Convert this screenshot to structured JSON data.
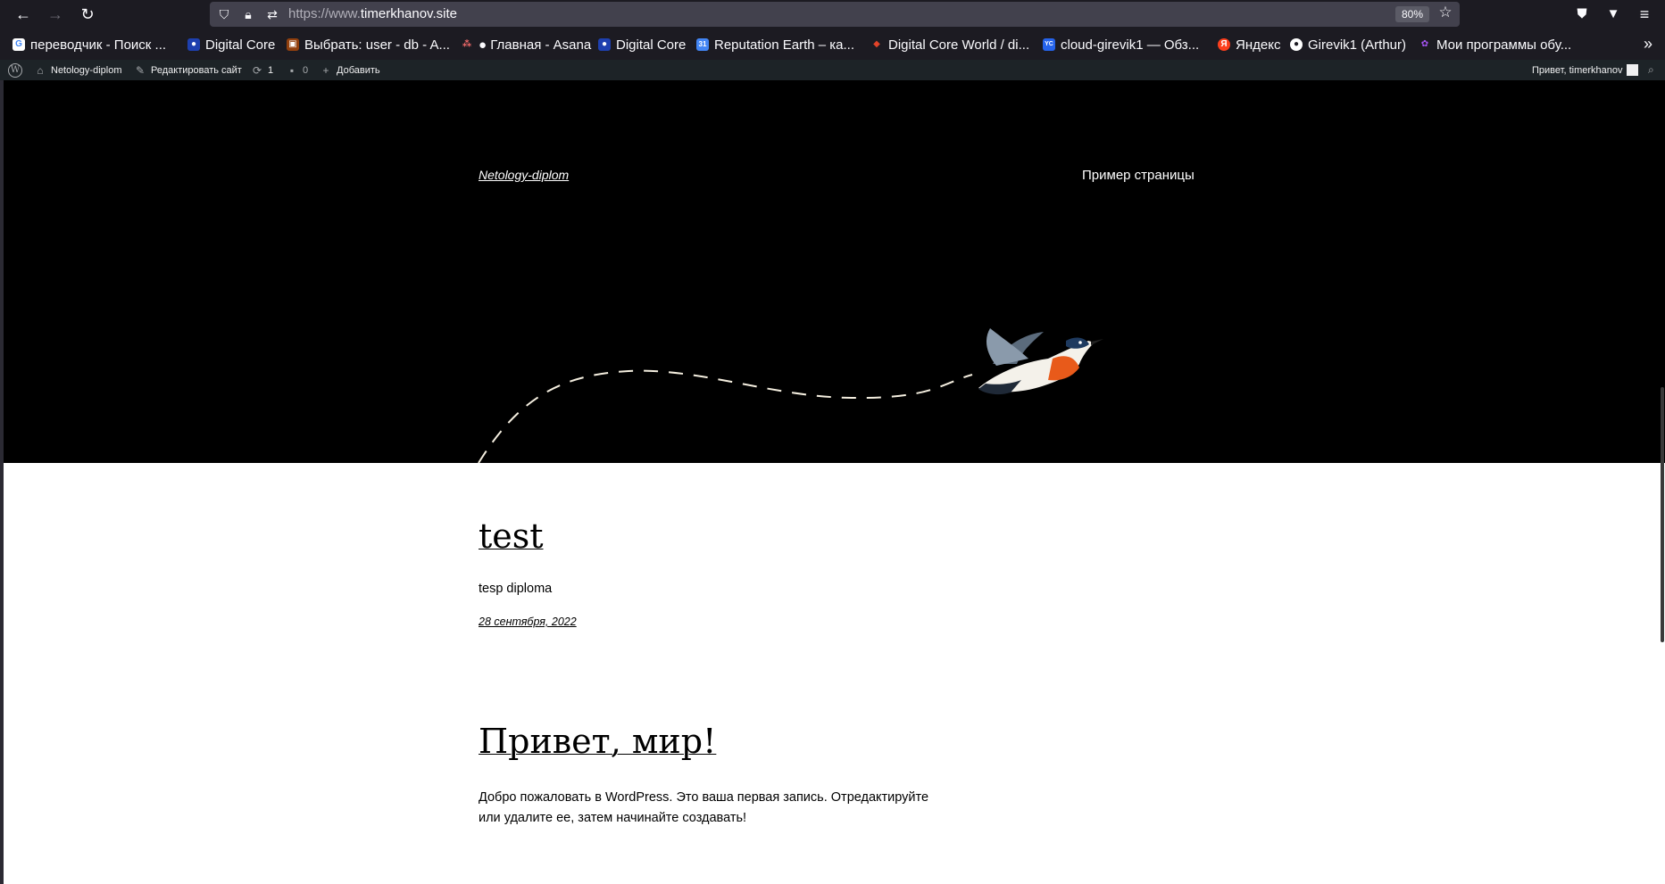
{
  "browser": {
    "url_prefix": "https://www.",
    "url_domain": "timerkhanov.site",
    "zoom": "80%"
  },
  "bookmarks": [
    {
      "label": "переводчик - Поиск ...",
      "icon": "G",
      "icon_color": "#ffffff"
    },
    {
      "label": "Digital Core",
      "icon": "●",
      "icon_color": "#3b82f6"
    },
    {
      "label": "Выбрать: user - db - A...",
      "icon": "▣",
      "icon_color": "#d97706"
    },
    {
      "label": "● Главная - Asana",
      "icon": "⁂",
      "icon_color": "#f06a6a"
    },
    {
      "label": "Digital Core",
      "icon": "●",
      "icon_color": "#3b82f6"
    },
    {
      "label": "Reputation Earth – ка...",
      "icon": "31",
      "icon_color": "#4285f4"
    },
    {
      "label": "Digital Core World / di...",
      "icon": "◆",
      "icon_color": "#e24329"
    },
    {
      "label": "cloud-girevik1 — Обз...",
      "icon": "YC",
      "icon_color": "#2563eb"
    },
    {
      "label": "Яндекс",
      "icon": "Я",
      "icon_color": "#fc3f1d"
    },
    {
      "label": "Girevik1 (Arthur)",
      "icon": "●",
      "icon_color": "#ffffff"
    },
    {
      "label": "Мои программы обу...",
      "icon": "✿",
      "icon_color": "#a855f7"
    }
  ],
  "adminbar": {
    "site_name": "Netology-diplom",
    "edit_site": "Редактировать сайт",
    "updates_count": "1",
    "comments_count": "0",
    "add_new": "Добавить",
    "greeting": "Привет, timerkhanov"
  },
  "site": {
    "title": "Netology-diplom",
    "nav_item": "Пример страницы"
  },
  "posts": [
    {
      "title": "test",
      "excerpt": "tesp diploma",
      "date": "28 сентября, 2022"
    },
    {
      "title": "Привет, мир!",
      "excerpt_line1": "Добро пожаловать в WordPress. Это ваша первая запись. Отредактируйте",
      "excerpt_line2": "или удалите ее, затем начинайте создавать!"
    }
  ]
}
